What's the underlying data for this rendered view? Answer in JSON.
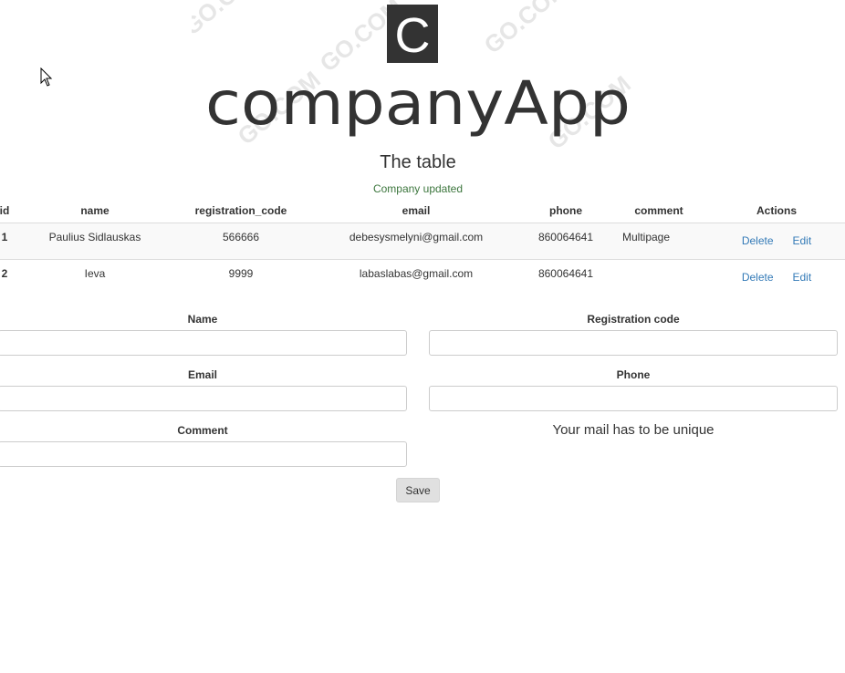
{
  "logo": {
    "letter": "C",
    "text": "companyApp",
    "watermark": "GO.COM"
  },
  "header": {
    "title": "The table",
    "status_message": "Company updated"
  },
  "table": {
    "columns": [
      "id",
      "name",
      "registration_code",
      "email",
      "phone",
      "comment",
      "Actions"
    ],
    "rows": [
      {
        "id": "1",
        "name": "Paulius Sidlauskas",
        "registration_code": "566666",
        "email": "debesysmelyni@gmail.com",
        "phone": "860064641",
        "comment": "Multipage"
      },
      {
        "id": "2",
        "name": "Ieva",
        "registration_code": "9999",
        "email": "labaslabas@gmail.com",
        "phone": "860064641",
        "comment": ""
      }
    ],
    "delete_label": "Delete",
    "edit_label": "Edit"
  },
  "form": {
    "name_label": "Name",
    "name_value": "",
    "registration_code_label": "Registration code",
    "registration_code_value": "",
    "email_label": "Email",
    "email_value": "",
    "phone_label": "Phone",
    "phone_value": "",
    "comment_label": "Comment",
    "comment_value": "",
    "unique_note": "Your mail has to be unique",
    "save_label": "Save"
  },
  "colors": {
    "status_green": "#3c763d",
    "link_blue": "#337ab7",
    "logo_dark": "#333333"
  }
}
